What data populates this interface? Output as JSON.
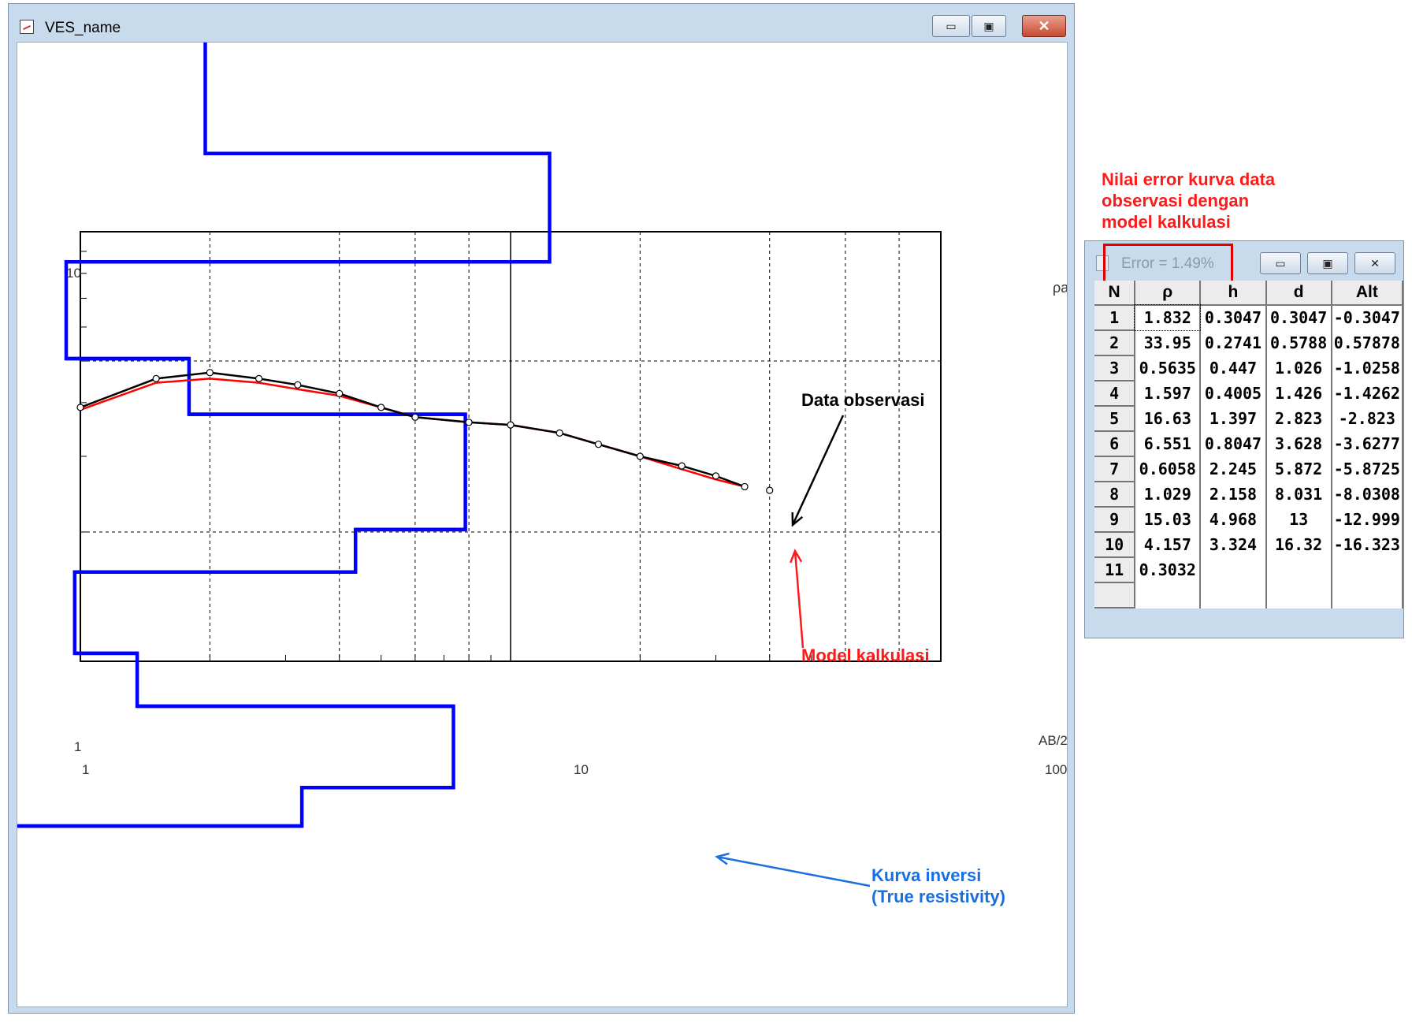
{
  "main_window": {
    "title": "VES_name",
    "buttons": {
      "minimize": "▭",
      "maximize": "▣",
      "close": "✕"
    }
  },
  "plot": {
    "y_axis_label": "ρa",
    "x_axis_label": "AB/2",
    "x_ticks": [
      "1",
      "10",
      "100"
    ],
    "y_ticks": [
      "10",
      "1"
    ],
    "colors": {
      "observed": "#000000",
      "model": "#ff0000",
      "inversion": "#0000ff"
    }
  },
  "chart_data": {
    "type": "line",
    "x_scale": "log",
    "y_scale": "log",
    "xlim": [
      1,
      100
    ],
    "ylim": [
      1,
      10
    ],
    "xlabel": "AB/2",
    "ylabel": "ρa",
    "grid": true,
    "series": [
      {
        "name": "Data observasi",
        "x": [
          1,
          1.5,
          2,
          2.6,
          3.2,
          4,
          5,
          6,
          8,
          10,
          13,
          16,
          20,
          25,
          30,
          35
        ],
        "y": [
          3.9,
          4.55,
          4.7,
          4.55,
          4.4,
          4.2,
          3.9,
          3.7,
          3.6,
          3.55,
          3.4,
          3.2,
          3.0,
          2.85,
          2.7,
          2.55
        ]
      },
      {
        "name": "Model kalkulasi",
        "x": [
          1,
          1.5,
          2,
          2.6,
          3.2,
          4,
          5,
          6,
          8,
          10,
          13,
          16,
          20,
          25,
          30,
          35
        ],
        "y": [
          3.85,
          4.45,
          4.55,
          4.45,
          4.3,
          4.15,
          3.9,
          3.7,
          3.6,
          3.55,
          3.4,
          3.2,
          3.0,
          2.8,
          2.65,
          2.55
        ]
      },
      {
        "name": "Kurva inversi",
        "layers": [
          {
            "rho": 1.832,
            "h": 0.3047,
            "d": 0.3047
          },
          {
            "rho": 33.95,
            "h": 0.2741,
            "d": 0.5788
          },
          {
            "rho": 0.5635,
            "h": 0.447,
            "d": 1.026
          },
          {
            "rho": 1.597,
            "h": 0.4005,
            "d": 1.426
          },
          {
            "rho": 16.63,
            "h": 1.397,
            "d": 2.823
          },
          {
            "rho": 6.551,
            "h": 0.8047,
            "d": 3.628
          },
          {
            "rho": 0.6058,
            "h": 2.245,
            "d": 5.872
          },
          {
            "rho": 1.029,
            "h": 2.158,
            "d": 8.031
          },
          {
            "rho": 15.03,
            "h": 4.968,
            "d": 13
          },
          {
            "rho": 4.157,
            "h": 3.324,
            "d": 16.32
          },
          {
            "rho": 0.3032
          }
        ]
      }
    ]
  },
  "annotations": {
    "data_observasi": "Data observasi",
    "model_kalkulasi": "Model kalkulasi",
    "kurva_inversi_line1": "Kurva inversi",
    "kurva_inversi_line2": "(True resistivity)",
    "error_note_line1": "Nilai error kurva data",
    "error_note_line2": "observasi dengan",
    "error_note_line3": "model kalkulasi"
  },
  "error_window": {
    "title": "Error = 1.49%",
    "buttons": {
      "minimize": "▭",
      "maximize": "▣",
      "close": "✕"
    },
    "columns": [
      "N",
      "ρ",
      "h",
      "d",
      "Alt"
    ],
    "rows": [
      [
        "1",
        "1.832",
        "0.3047",
        "0.3047",
        "-0.3047"
      ],
      [
        "2",
        "33.95",
        "0.2741",
        "0.5788",
        "0.57878"
      ],
      [
        "3",
        "0.5635",
        "0.447",
        "1.026",
        "-1.0258"
      ],
      [
        "4",
        "1.597",
        "0.4005",
        "1.426",
        "-1.4262"
      ],
      [
        "5",
        "16.63",
        "1.397",
        "2.823",
        "-2.823"
      ],
      [
        "6",
        "6.551",
        "0.8047",
        "3.628",
        "-3.6277"
      ],
      [
        "7",
        "0.6058",
        "2.245",
        "5.872",
        "-5.8725"
      ],
      [
        "8",
        "1.029",
        "2.158",
        "8.031",
        "-8.0308"
      ],
      [
        "9",
        "15.03",
        "4.968",
        "13",
        "-12.999"
      ],
      [
        "10",
        "4.157",
        "3.324",
        "16.32",
        "-16.323"
      ],
      [
        "11",
        "0.3032",
        "",
        "",
        ""
      ],
      [
        "",
        "",
        "",
        "",
        ""
      ]
    ]
  }
}
